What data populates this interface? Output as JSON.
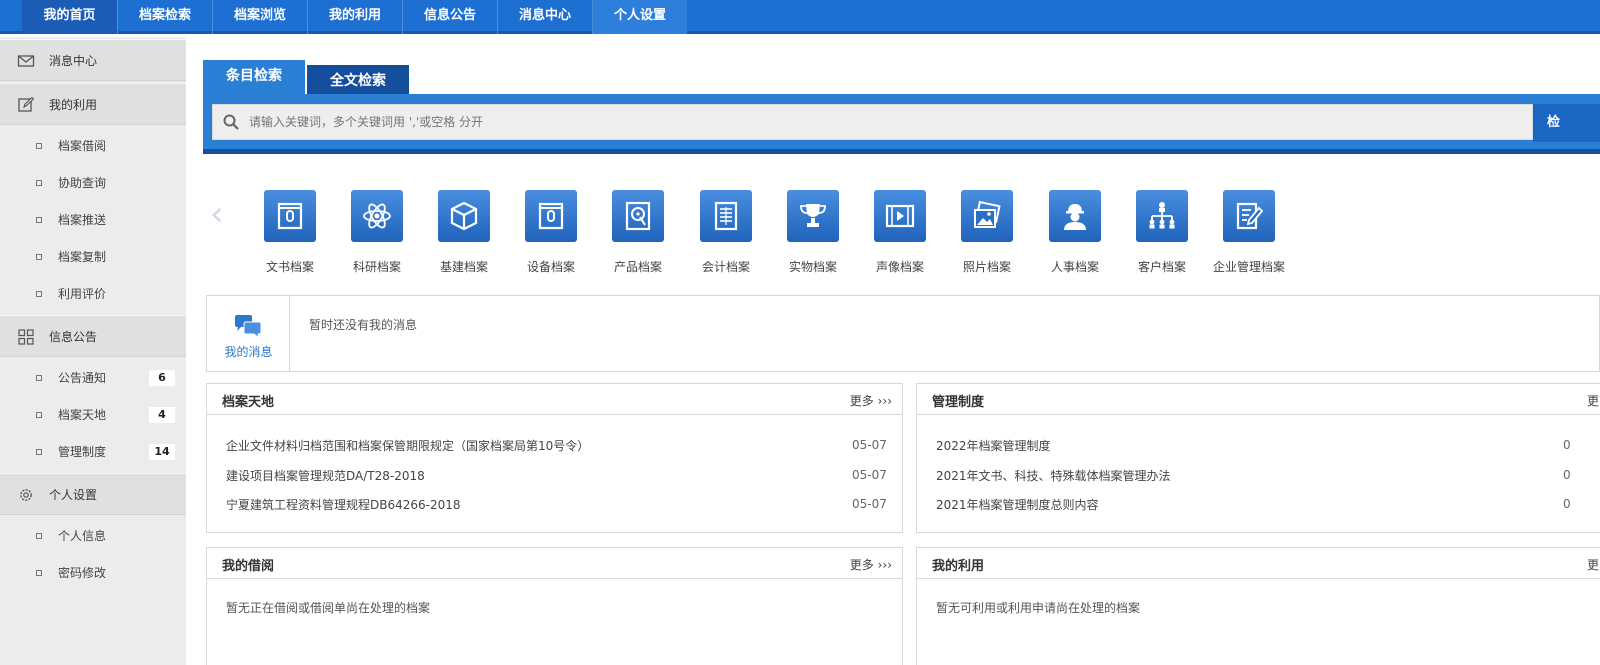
{
  "topnav": {
    "items": [
      "我的首页",
      "档案检索",
      "档案浏览",
      "我的利用",
      "信息公告",
      "消息中心",
      "个人设置"
    ]
  },
  "sidebar": {
    "message_center": "消息中心",
    "my_use": "我的利用",
    "my_use_items": [
      "档案借阅",
      "协助查询",
      "档案推送",
      "档案复制",
      "利用评价"
    ],
    "info": "信息公告",
    "info_items": [
      {
        "label": "公告通知",
        "count": "6"
      },
      {
        "label": "档案天地",
        "count": "4"
      },
      {
        "label": "管理制度",
        "count": "14"
      }
    ],
    "personal": "个人设置",
    "personal_items": [
      "个人信息",
      "密码修改"
    ]
  },
  "search": {
    "tabs": [
      "条目检索",
      "全文检索"
    ],
    "placeholder": "请输入关键词，多个关键词用 ','或空格 分开",
    "button": "检"
  },
  "categories": [
    {
      "label": "文书档案",
      "icon": "document-bag-icon"
    },
    {
      "label": "科研档案",
      "icon": "atom-icon"
    },
    {
      "label": "基建档案",
      "icon": "cube-icon"
    },
    {
      "label": "设备档案",
      "icon": "device-bag-icon"
    },
    {
      "label": "产品档案",
      "icon": "disk-icon"
    },
    {
      "label": "会计档案",
      "icon": "ledger-icon"
    },
    {
      "label": "实物档案",
      "icon": "trophy-icon"
    },
    {
      "label": "声像档案",
      "icon": "film-icon"
    },
    {
      "label": "照片档案",
      "icon": "photo-icon"
    },
    {
      "label": "人事档案",
      "icon": "worker-icon"
    },
    {
      "label": "客户档案",
      "icon": "org-chart-icon"
    },
    {
      "label": "企业管理档案",
      "icon": "edit-doc-icon"
    }
  ],
  "messages": {
    "label": "我的消息",
    "empty": "暂时还没有我的消息"
  },
  "panels": {
    "archive_world": {
      "title": "档案天地",
      "more": "更多 ›››",
      "rows": [
        {
          "text": "企业文件材料归档范围和档案保管期限规定（国家档案局第10号令）",
          "date": "05-07"
        },
        {
          "text": "建设项目档案管理规范DA/T28-2018",
          "date": "05-07"
        },
        {
          "text": "宁夏建筑工程资料管理规程DB64266-2018",
          "date": "05-07"
        }
      ]
    },
    "management": {
      "title": "管理制度",
      "more": "更",
      "rows": [
        {
          "text": "2022年档案管理制度",
          "date": "0"
        },
        {
          "text": "2021年文书、科技、特殊载体档案管理办法",
          "date": "0"
        },
        {
          "text": "2021年档案管理制度总则内容",
          "date": "0"
        }
      ]
    },
    "my_borrow": {
      "title": "我的借阅",
      "more": "更多 ›››",
      "empty": "暂无正在借阅或借阅单尚在处理的档案"
    },
    "my_use": {
      "title": "我的利用",
      "more": "更",
      "empty": "暂无可利用或利用申请尚在处理的档案"
    }
  }
}
